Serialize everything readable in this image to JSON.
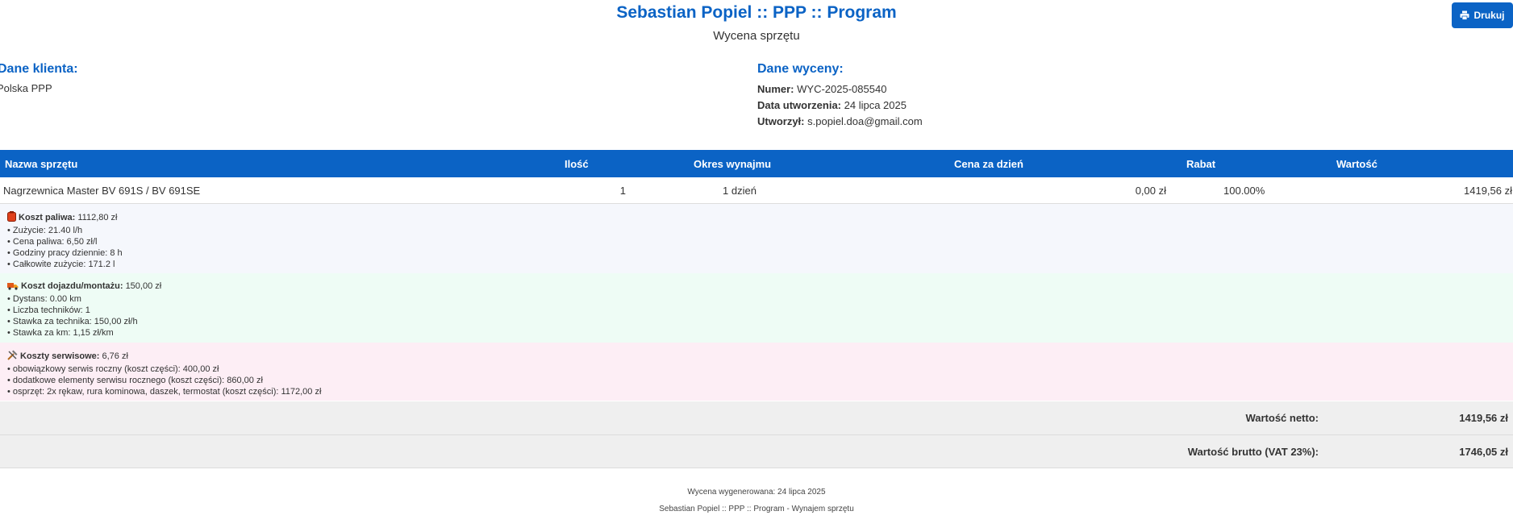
{
  "header": {
    "title": "Sebastian Popiel :: PPP :: Program",
    "subtitle": "Wycena sprzętu",
    "print_label": "Drukuj"
  },
  "client": {
    "heading": "Dane klienta:",
    "name": "Polska PPP"
  },
  "quote": {
    "heading": "Dane wyceny:",
    "number_label": "Numer:",
    "number": "WYC-2025-085540",
    "date_label": "Data utworzenia:",
    "date": "24 lipca 2025",
    "author_label": "Utworzył:",
    "author": "s.popiel.doa@gmail.com"
  },
  "table": {
    "headers": [
      "Nazwa sprzętu",
      "Ilość",
      "Okres wynajmu",
      "Cena za dzień",
      "Rabat",
      "Wartość"
    ],
    "row": {
      "name": "Nagrzewnica Master BV 691S / BV 691SE",
      "qty": "1",
      "period": "1 dzień",
      "price": "0,00 zł",
      "discount": "100.00%",
      "value": "1419,56 zł"
    }
  },
  "costs": {
    "fuel": {
      "icon": "fuel-can-icon",
      "label": "Koszt paliwa:",
      "value": "1112,80 zł",
      "lines": [
        "• Zużycie: 21.40 l/h",
        "• Cena paliwa: 6,50 zł/l",
        "• Godziny pracy dziennie: 8 h",
        "• Całkowite zużycie: 171.2 l"
      ],
      "bg": "#f5f7fc"
    },
    "transport": {
      "icon": "truck-icon",
      "label": "Koszt dojazdu/montażu:",
      "value": "150,00 zł",
      "lines": [
        "• Dystans: 0.00 km",
        "• Liczba techników: 1",
        "• Stawka za technika: 150,00 zł/h",
        "• Stawka za km: 1,15 zł/km"
      ],
      "bg": "#eefcf5"
    },
    "service": {
      "icon": "tools-icon",
      "label": "Koszty serwisowe:",
      "value": "6,76 zł",
      "lines": [
        "• obowiązkowy serwis roczny (koszt części): 400,00 zł",
        "• dodatkowe elementy serwisu rocznego (koszt części): 860,00 zł",
        "• osprzęt: 2x rękaw, rura kominowa, daszek, termostat (koszt części): 1172,00 zł"
      ],
      "bg": "#fdeef5"
    }
  },
  "totals": {
    "net_label": "Wartość netto:",
    "net_value": "1419,56 zł",
    "gross_label": "Wartość brutto (VAT 23%):",
    "gross_value": "1746,05 zł"
  },
  "footer": {
    "generated": "Wycena wygenerowana: 24 lipca 2025",
    "brand": "Sebastian Popiel :: PPP :: Program - Wynajem sprzętu"
  },
  "colors": {
    "accent": "#0b63c5",
    "totals_bg": "#efefef"
  }
}
